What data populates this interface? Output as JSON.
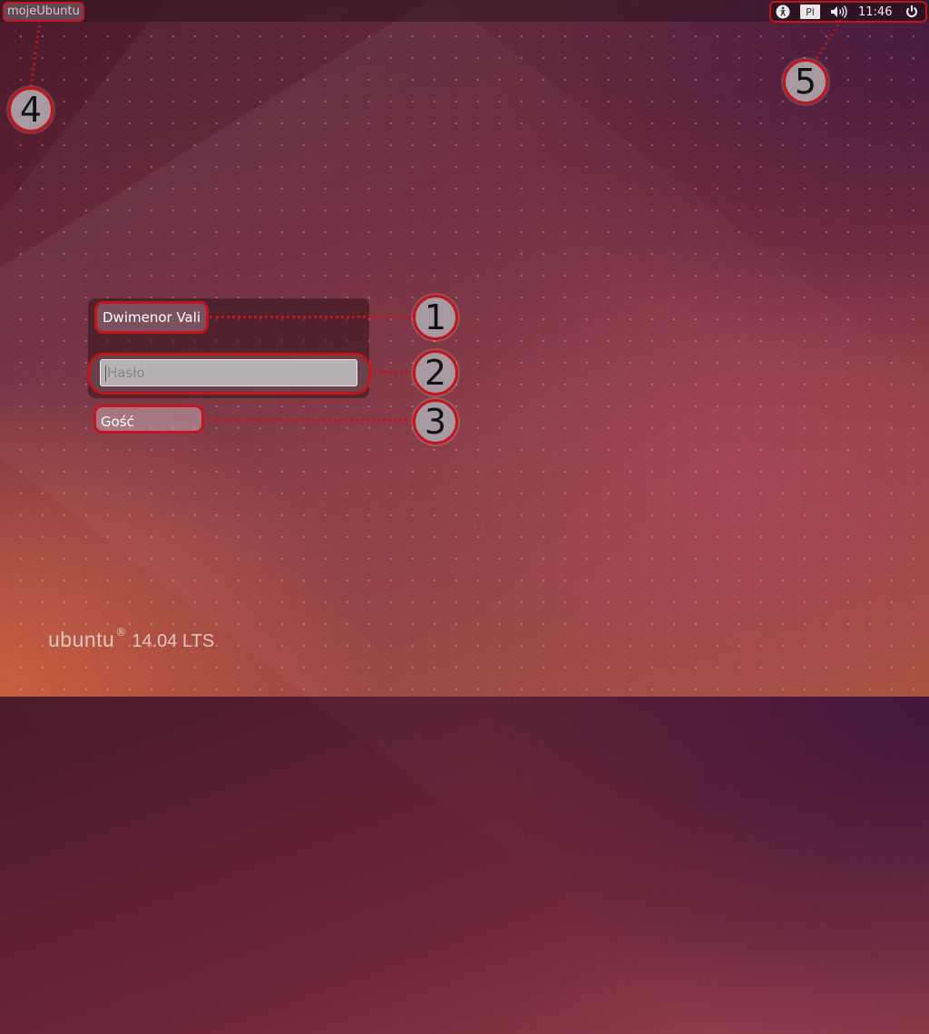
{
  "panel": {
    "hostname": "mojeUbuntu",
    "keyboard_layout": "Pl",
    "clock": "11:46",
    "icons": [
      "accessibility-icon",
      "volume-icon",
      "power-icon"
    ]
  },
  "greeter": {
    "user_name": "Dwimenor Vali",
    "password_placeholder": "Hasło",
    "guest_label": "Gość"
  },
  "callouts": [
    "1",
    "2",
    "3",
    "4",
    "5"
  ],
  "brand": {
    "wordmark": "ubuntu",
    "circle_mark": "®",
    "version": "14.04 LTS"
  },
  "colors": {
    "callout_border": "#c1161d",
    "callout_fill": "#a89aa2"
  }
}
